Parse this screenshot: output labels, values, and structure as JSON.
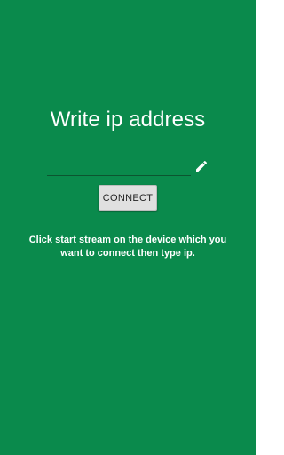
{
  "theme": {
    "background": "#0a8a4c",
    "text": "#ffffff",
    "button": "#e0e0e0"
  },
  "main": {
    "title": "Write ip address",
    "ip_input": {
      "value": "",
      "placeholder": ""
    },
    "edit_icon": "pencil-icon",
    "connect_label": "CONNECT",
    "instructions": "Click start stream on the device which you want to connect then type ip."
  }
}
